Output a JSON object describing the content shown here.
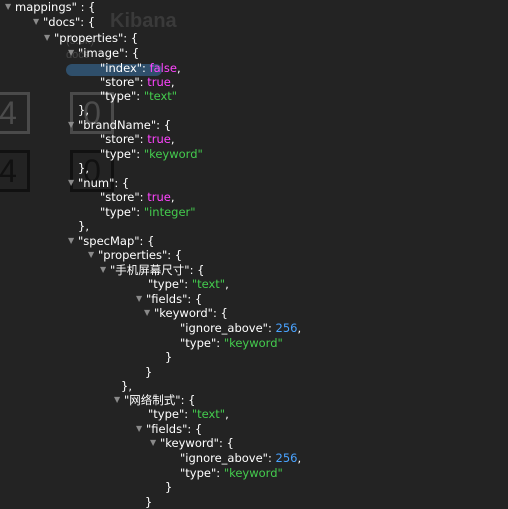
{
  "background": {
    "title": "Kibana",
    "size_hint": "(5.5k)",
    "host": "docs",
    "box_digits": [
      "4",
      "0",
      "4",
      "0"
    ]
  },
  "colors": {
    "background": "#232323",
    "key": "#ffffff",
    "string": "#44cc4e",
    "boolean": "#ff44ff",
    "number": "#4aa3ff"
  },
  "lines": [
    {
      "segs": [
        {
          "t": "mappings",
          "c": "k"
        },
        {
          "t": "\" : {",
          "c": "p"
        }
      ]
    },
    {
      "segs": [
        {
          "t": "\"docs\": {",
          "c": "k"
        }
      ]
    },
    {
      "segs": [
        {
          "t": "\"properties\": {",
          "c": "k"
        }
      ]
    },
    {
      "segs": [
        {
          "t": "\"image\": {",
          "c": "k"
        }
      ]
    },
    {
      "segs": [
        {
          "t": "\"index\": ",
          "c": "k"
        },
        {
          "t": "false",
          "c": "bv"
        },
        {
          "t": ",",
          "c": "p"
        }
      ]
    },
    {
      "segs": [
        {
          "t": "\"store\": ",
          "c": "k"
        },
        {
          "t": "true",
          "c": "bv"
        },
        {
          "t": ",",
          "c": "p"
        }
      ]
    },
    {
      "segs": [
        {
          "t": "\"type\": ",
          "c": "k"
        },
        {
          "t": "\"text\"",
          "c": "sv"
        }
      ]
    },
    {
      "segs": [
        {
          "t": "},",
          "c": "p"
        }
      ]
    },
    {
      "segs": [
        {
          "t": "\"brandName\": {",
          "c": "k"
        }
      ]
    },
    {
      "segs": [
        {
          "t": "\"store\": ",
          "c": "k"
        },
        {
          "t": "true",
          "c": "bv"
        },
        {
          "t": ",",
          "c": "p"
        }
      ]
    },
    {
      "segs": [
        {
          "t": "\"type\": ",
          "c": "k"
        },
        {
          "t": "\"keyword\"",
          "c": "sv"
        }
      ]
    },
    {
      "segs": [
        {
          "t": "},",
          "c": "p"
        }
      ]
    },
    {
      "segs": [
        {
          "t": "\"num\": {",
          "c": "k"
        }
      ]
    },
    {
      "segs": [
        {
          "t": "\"store\": ",
          "c": "k"
        },
        {
          "t": "true",
          "c": "bv"
        },
        {
          "t": ",",
          "c": "p"
        }
      ]
    },
    {
      "segs": [
        {
          "t": "\"type\": ",
          "c": "k"
        },
        {
          "t": "\"integer\"",
          "c": "sv"
        }
      ]
    },
    {
      "segs": [
        {
          "t": "},",
          "c": "p"
        }
      ]
    },
    {
      "segs": [
        {
          "t": "\"specMap\": {",
          "c": "k"
        }
      ]
    },
    {
      "segs": [
        {
          "t": "\"properties\": {",
          "c": "k"
        }
      ]
    },
    {
      "segs": [
        {
          "t": "\"手机屏幕尺寸\": {",
          "c": "k"
        }
      ]
    },
    {
      "segs": [
        {
          "t": "\"type\": ",
          "c": "k"
        },
        {
          "t": "\"text\"",
          "c": "sv"
        },
        {
          "t": ",",
          "c": "p"
        }
      ]
    },
    {
      "segs": [
        {
          "t": "\"fields\": {",
          "c": "k"
        }
      ]
    },
    {
      "segs": [
        {
          "t": "\"keyword\": {",
          "c": "k"
        }
      ]
    },
    {
      "segs": [
        {
          "t": "\"ignore_above\": ",
          "c": "k"
        },
        {
          "t": "256",
          "c": "nv"
        },
        {
          "t": ",",
          "c": "p"
        }
      ]
    },
    {
      "segs": [
        {
          "t": "\"type\": ",
          "c": "k"
        },
        {
          "t": "\"keyword\"",
          "c": "sv"
        }
      ]
    },
    {
      "segs": [
        {
          "t": "}",
          "c": "p"
        }
      ]
    },
    {
      "segs": [
        {
          "t": "}",
          "c": "p"
        }
      ]
    },
    {
      "segs": [
        {
          "t": "},",
          "c": "p"
        }
      ]
    },
    {
      "segs": [
        {
          "t": "\"网络制式\": {",
          "c": "k"
        }
      ]
    },
    {
      "segs": [
        {
          "t": "\"type\": ",
          "c": "k"
        },
        {
          "t": "\"text\"",
          "c": "sv"
        },
        {
          "t": ",",
          "c": "p"
        }
      ]
    },
    {
      "segs": [
        {
          "t": "\"fields\": {",
          "c": "k"
        }
      ]
    },
    {
      "segs": [
        {
          "t": "\"keyword\": {",
          "c": "k"
        }
      ]
    },
    {
      "segs": [
        {
          "t": "\"ignore_above\": ",
          "c": "k"
        },
        {
          "t": "256",
          "c": "nv"
        },
        {
          "t": ",",
          "c": "p"
        }
      ]
    },
    {
      "segs": [
        {
          "t": "\"type\": ",
          "c": "k"
        },
        {
          "t": "\"keyword\"",
          "c": "sv"
        }
      ]
    },
    {
      "segs": [
        {
          "t": "}",
          "c": "p"
        }
      ]
    },
    {
      "segs": [
        {
          "t": "}",
          "c": "p"
        }
      ]
    }
  ]
}
